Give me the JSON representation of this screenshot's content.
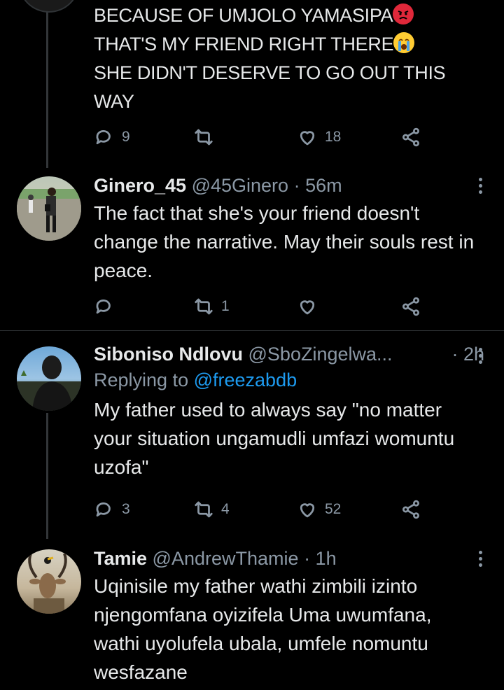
{
  "tweets": [
    {
      "lines": [
        "BECAUSE OF UMJOLO YAMASIPA",
        "THAT'S MY FRIEND RIGHT THERE",
        "SHE DIDN'T DESERVE TO GO OUT THIS",
        "WAY"
      ],
      "emoji": [
        "angry-face",
        "loudly-crying-face"
      ],
      "replies": "9",
      "retweets": "",
      "likes": "18"
    },
    {
      "name": "Ginero_45",
      "handle": "@45Ginero",
      "time": "· 56m",
      "text": "The fact that she's your friend doesn't change the narrative. May their souls rest in peace.",
      "replies": "",
      "retweets": "1",
      "likes": ""
    },
    {
      "name": "Siboniso Ndlovu",
      "handle": "@SboZingelwa...",
      "time": "· 2h",
      "replying_label": "Replying to",
      "replying_to": "@freezabdb",
      "text": "My father used to always say \"no matter your situation ungamudli umfazi womuntu uzofa\"",
      "replies": "3",
      "retweets": "4",
      "likes": "52"
    },
    {
      "name": "Tamie",
      "handle": "@AndrewThamie",
      "time": "· 1h",
      "text": "Uqinisile my father wathi zimbili izinto njengomfana oyizifela Uma uwumfana, wathi uyolufela ubala, umfele nomuntu wesfazane"
    }
  ],
  "colors": {
    "background": "#000000",
    "text": "#e7e9ea",
    "muted": "#8b98a5",
    "link": "#1d9bf0",
    "divider": "#2f3336"
  },
  "icons": [
    "reply-icon",
    "retweet-icon",
    "like-icon",
    "share-icon",
    "more-icon"
  ]
}
